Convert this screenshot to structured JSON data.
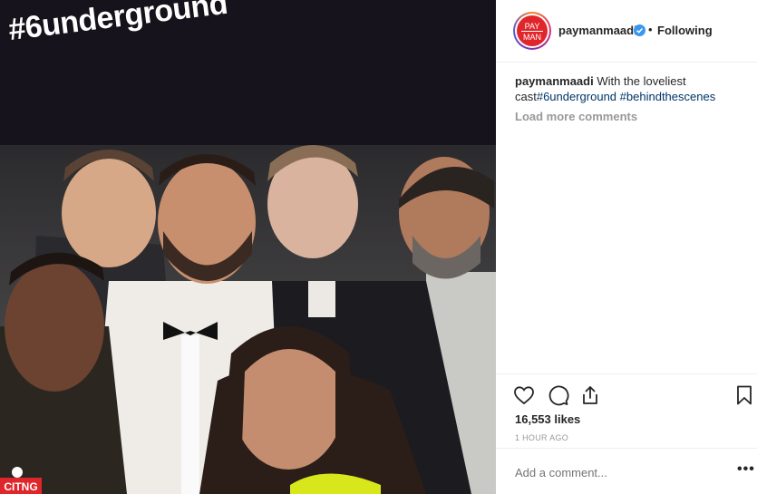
{
  "post": {
    "sticker_text": "#6underground",
    "watermark": "CITNG"
  },
  "header": {
    "avatar_text_top": "PAY",
    "avatar_text_bottom": "MAN",
    "username": "paymanmaadi",
    "separator": "•",
    "following_label": "Following",
    "verified": true
  },
  "caption": {
    "username": "paymanmaadi",
    "text": " With the loveliest cast",
    "hashtag1": "#6underground",
    "space": " ",
    "hashtag2": "#behindthescenes"
  },
  "comments": {
    "load_more_label": "Load more comments"
  },
  "actions": {
    "like": "heart-icon",
    "comment": "comment-icon",
    "share": "share-icon",
    "save": "bookmark-icon"
  },
  "stats": {
    "likes": "16,553 likes",
    "time": "1 HOUR AGO"
  },
  "add_comment": {
    "placeholder": "Add a comment...",
    "more": "•••"
  },
  "colors": {
    "tag_link": "#003569",
    "muted": "#999999",
    "avatar_bg": "#e0262b",
    "verified": "#3897f0"
  }
}
